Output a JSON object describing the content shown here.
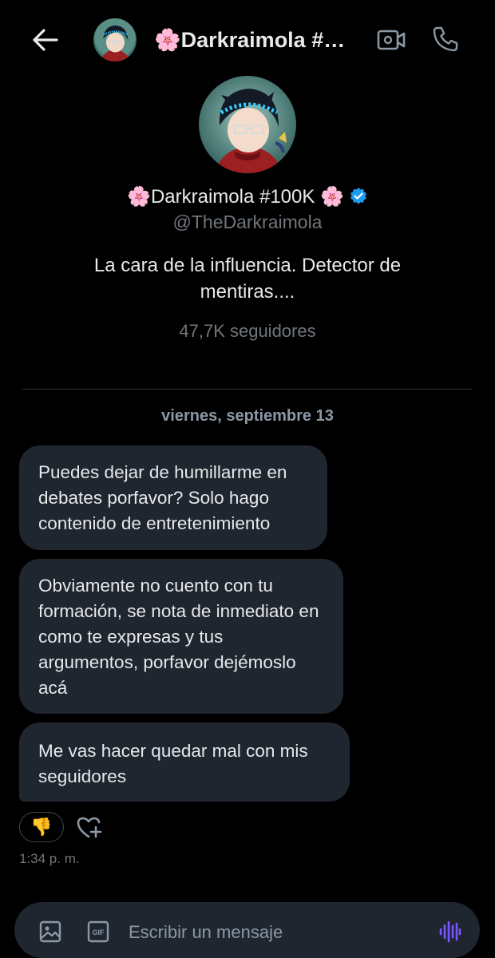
{
  "header": {
    "name": "🌸Darkraimola #100K 🌸",
    "icons": {
      "back": "arrow-left-icon",
      "video": "video-camera-icon",
      "call": "phone-icon"
    }
  },
  "profile": {
    "name": "🌸Darkraimola #100K 🌸",
    "handle": "@TheDarkraimola",
    "bio": "La cara de la influencia. Detector de mentiras....",
    "followers": "47,7K seguidores",
    "verified_color": "#1d9bf0"
  },
  "conversation": {
    "date": "viernes, septiembre 13",
    "messages": [
      {
        "text": "Puedes dejar de humillarme en debates porfavor? Solo hago contenido de entretenimiento"
      },
      {
        "text": "Obviamente no cuento con tu formación, se nota de inmediato en como te expresas y tus argumentos, porfavor dejémoslo acá"
      },
      {
        "text": "Me vas hacer quedar mal con mis seguidores"
      }
    ],
    "reaction": "👎",
    "timestamp": "1:34 p. m."
  },
  "composer": {
    "placeholder": "Escribir un mensaje",
    "icons": {
      "image": "image-icon",
      "gif": "gif-icon",
      "voice": "voice-wave-icon"
    },
    "voice_color": "#7856ff"
  },
  "colors": {
    "background": "#000000",
    "bubble": "#1f2630",
    "text": "#e7e9ea",
    "secondary_text": "#71767b"
  }
}
